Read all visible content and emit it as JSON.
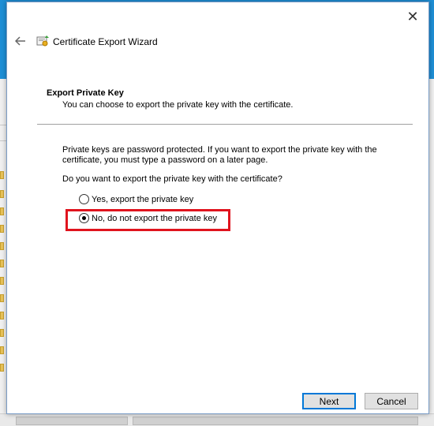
{
  "window": {
    "title": "Certificate Export Wizard"
  },
  "page": {
    "heading": "Export Private Key",
    "subheading": "You can choose to export the private key with the certificate.",
    "description": "Private keys are password protected. If you want to export the private key with the certificate, you must type a password on a later page.",
    "question": "Do you want to export the private key with the certificate?"
  },
  "options": [
    {
      "label": "Yes, export the private key",
      "checked": false
    },
    {
      "label": "No, do not export the private key",
      "checked": true
    }
  ],
  "buttons": {
    "next": "Next",
    "cancel": "Cancel"
  },
  "icons": {
    "close": "close-icon",
    "back": "back-arrow-icon",
    "wizard": "certificate-icon"
  },
  "colors": {
    "accent": "#0078d7",
    "highlight": "#e0141e",
    "desktop": "#1e8fd6"
  }
}
